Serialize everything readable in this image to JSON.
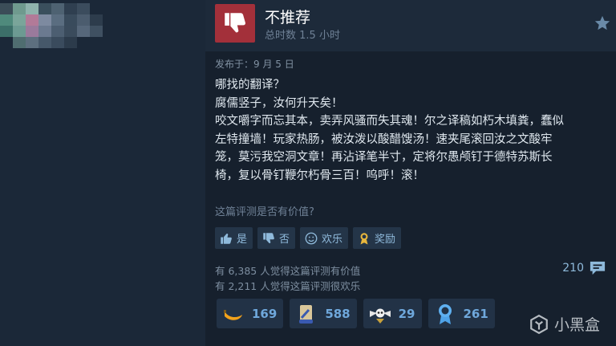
{
  "review": {
    "verdict": "不推荐",
    "hours": "总时数 1.5 小时",
    "posted": "发布于：9 月 5 日",
    "body_lines": [
      "哪找的翻译？",
      "腐儒竖子，汝何升天矣！",
      "咬文嚼字而忘其本，卖弄风骚而失其魂！尔之译稿如朽木填粪，蠢似",
      "左特撞墙！玩家热肠，被汝泼以酸醋馊汤！速夹尾滚回汝之文酸牢",
      "笼，莫污我空洞文章！再沾译笔半寸，定将尔愚颅钉于德特苏斯长",
      "椅，复以骨钉鞭尔朽骨三百！呜呼！滚！"
    ]
  },
  "vote": {
    "question": "这篇评测是否有价值?",
    "yes": "是",
    "no": "否",
    "funny": "欢乐",
    "award": "奖励"
  },
  "counts": {
    "helpful": "有 6,385 人觉得这篇评测有价值",
    "funny": "有 2,211 人觉得这篇评测很欢乐"
  },
  "comments": "210",
  "awards": [
    {
      "icon": "banana-award-icon",
      "count": "169"
    },
    {
      "icon": "scroll-award-icon",
      "count": "588"
    },
    {
      "icon": "winged-skull-award-icon",
      "count": "29"
    },
    {
      "icon": "medal-award-icon",
      "count": "261"
    }
  ],
  "watermark": "小黑盒",
  "colors": {
    "background": "#1b2838",
    "not_recommended": "#a3303a",
    "link_blue": "#6fa8dc"
  }
}
